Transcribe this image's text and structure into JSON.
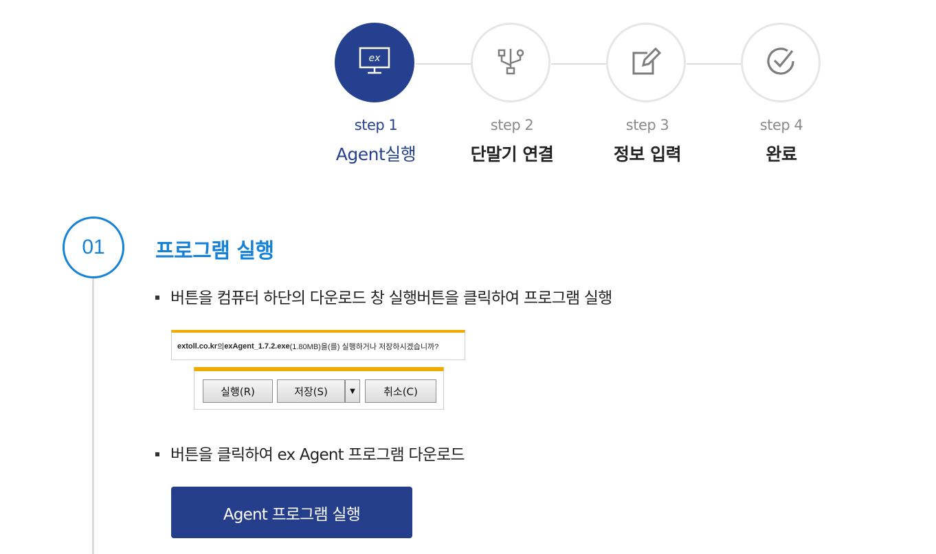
{
  "steps": [
    {
      "num": "step 1",
      "title": "Agent실행",
      "icon": "monitor-ex-icon",
      "active": true
    },
    {
      "num": "step 2",
      "title": "단말기 연결",
      "icon": "usb-icon",
      "active": false
    },
    {
      "num": "step 3",
      "title": "정보 입력",
      "icon": "edit-icon",
      "active": false
    },
    {
      "num": "step 4",
      "title": "완료",
      "icon": "check-circle-icon",
      "active": false
    }
  ],
  "monitor_icon_text": "ex",
  "section": {
    "number": "01",
    "title": "프로그램 실행",
    "bullet1": "버튼을 컴퓨터 하단의 다운로드 창 실행버튼을 클릭하여 프로그램 실행",
    "bullet2": "버튼을 클릭하여 ex Agent 프로그램 다운로드",
    "download_bar": {
      "domain": "extoll.co.kr",
      "mid1": "의 ",
      "file": "exAgent_1.7.2.exe",
      "rest": "(1.80MB)을(를) 실행하거나 저장하시겠습니까?"
    },
    "download_buttons": {
      "run": "실행(R)",
      "save": "저장(S)",
      "arrow": "▼",
      "cancel": "취소(C)"
    },
    "agent_button": "Agent 프로그램 실행"
  },
  "colors": {
    "primary": "#25408f",
    "accent_blue": "#1582d8",
    "download_bar": "#f2a900"
  }
}
